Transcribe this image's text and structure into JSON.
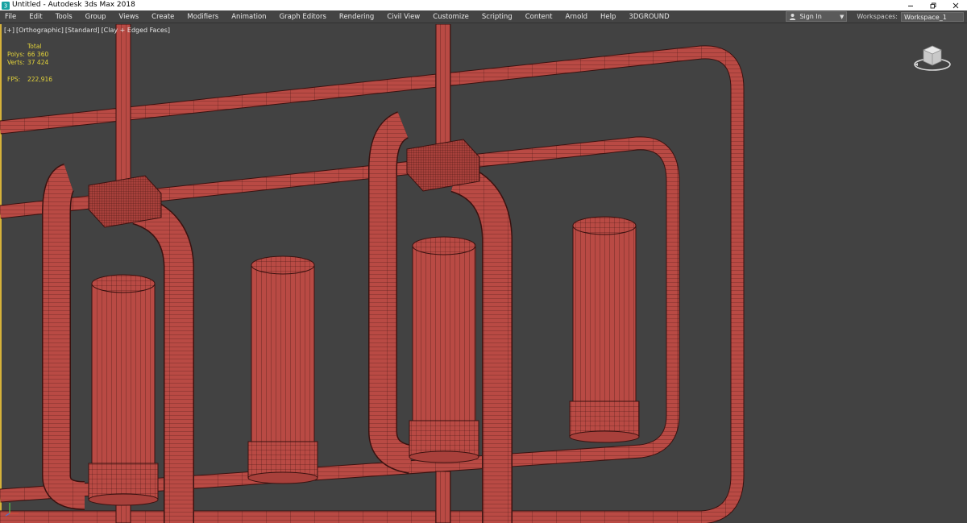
{
  "window": {
    "title": "Untitled - Autodesk 3ds Max 2018",
    "icon": "3dsmax-app-icon",
    "controls": [
      "minimize-icon",
      "restore-icon",
      "close-icon"
    ]
  },
  "menu": {
    "items": [
      "File",
      "Edit",
      "Tools",
      "Group",
      "Views",
      "Create",
      "Modifiers",
      "Animation",
      "Graph Editors",
      "Rendering",
      "Civil View",
      "Customize",
      "Scripting",
      "Content",
      "Arnold",
      "Help",
      "3DGROUND"
    ],
    "sign_in": "Sign In",
    "workspaces_label": "Workspaces:",
    "workspace_value": "Workspace_1"
  },
  "viewport": {
    "label_parts": [
      "[+]",
      "[Orthographic]",
      "[Standard]",
      "[Clay + Edged Faces]"
    ],
    "stats": {
      "total_label": "Total",
      "polys_label": "Polys:",
      "polys_value": "66 360",
      "verts_label": "Verts:",
      "verts_value": "37 424",
      "fps_label": "FPS:",
      "fps_value": "222,916"
    },
    "colors": {
      "background": "#424242",
      "mesh_fill": "#b94a44",
      "mesh_wire": "#3a1210",
      "active_border": "#d6b23a",
      "stats_text": "#e3d33a"
    }
  }
}
